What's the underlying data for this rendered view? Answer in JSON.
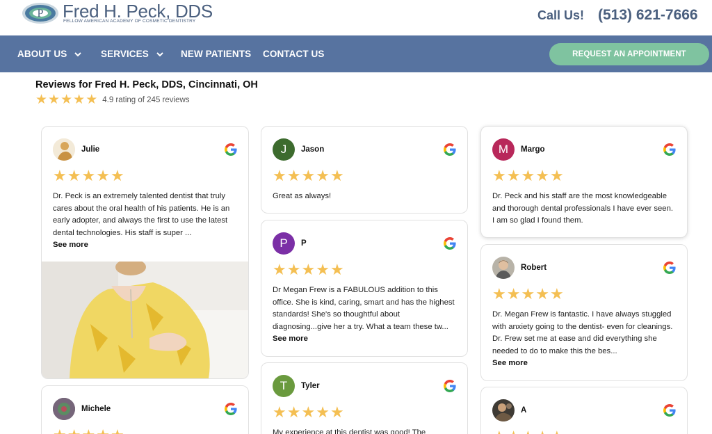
{
  "brand": {
    "name": "Fred H. Peck, DDS",
    "subtitle": "FELLOW AMERICAN ACADEMY OF COSMETIC DENTISTRY",
    "call_label": "Call Us!",
    "phone": "(513) 621-7666"
  },
  "nav": {
    "items": [
      {
        "label": "ABOUT US"
      },
      {
        "label": "SERVICES"
      },
      {
        "label": "NEW PATIENTS"
      },
      {
        "label": "CONTACT US"
      }
    ],
    "cta": "REQUEST AN APPOINTMENT"
  },
  "reviews_header": {
    "title": "Reviews for Fred H. Peck, DDS, Cincinnati, OH",
    "rating_text": "4.9 rating of 245 reviews",
    "stars": 5
  },
  "colors": {
    "nav_bg": "#5773a0",
    "cta_bg": "#7fc3a0",
    "star": "#f4bf53",
    "brand_text": "#4a5f7e"
  },
  "reviews": [
    {
      "name": "Julie",
      "avatar": "photo",
      "stars": 5,
      "text": "Dr. Peck is an extremely talented dentist that truly cares about the oral health of his patients. He is an early adopter, and always the first to use the latest dental technologies. His staff is super ...",
      "see_more": "See more"
    },
    {
      "name": "Michele",
      "avatar": "photo",
      "stars": 5
    },
    {
      "name": "Jason",
      "initial": "J",
      "stars": 5,
      "text": "Great as always!"
    },
    {
      "name": "P",
      "initial": "P",
      "stars": 5,
      "text": "Dr Megan Frew is a FABULOUS addition to this office. She is kind, caring, smart and has the highest standards! She's so thoughtful about diagnosing...give her a try. What a team these tw...",
      "see_more": "See more"
    },
    {
      "name": "Tyler",
      "initial": "T",
      "stars": 5,
      "text": "My experience at this dentist was good! The"
    },
    {
      "name": "Margo",
      "initial": "M",
      "stars": 5,
      "text": "Dr. Peck and his staff are the most knowledgeable and thorough dental professionals I have ever seen.  I am so glad I found them."
    },
    {
      "name": "Robert",
      "avatar": "photo",
      "stars": 5,
      "text": "Dr. Megan Frew is fantastic.  I have always stuggled with anxiety going to the dentist- even for cleanings.  Dr. Frew set me at ease and did everything she needed to do to make this the bes...",
      "see_more": "See more"
    },
    {
      "name": "A",
      "avatar": "photo",
      "stars": 5
    }
  ]
}
